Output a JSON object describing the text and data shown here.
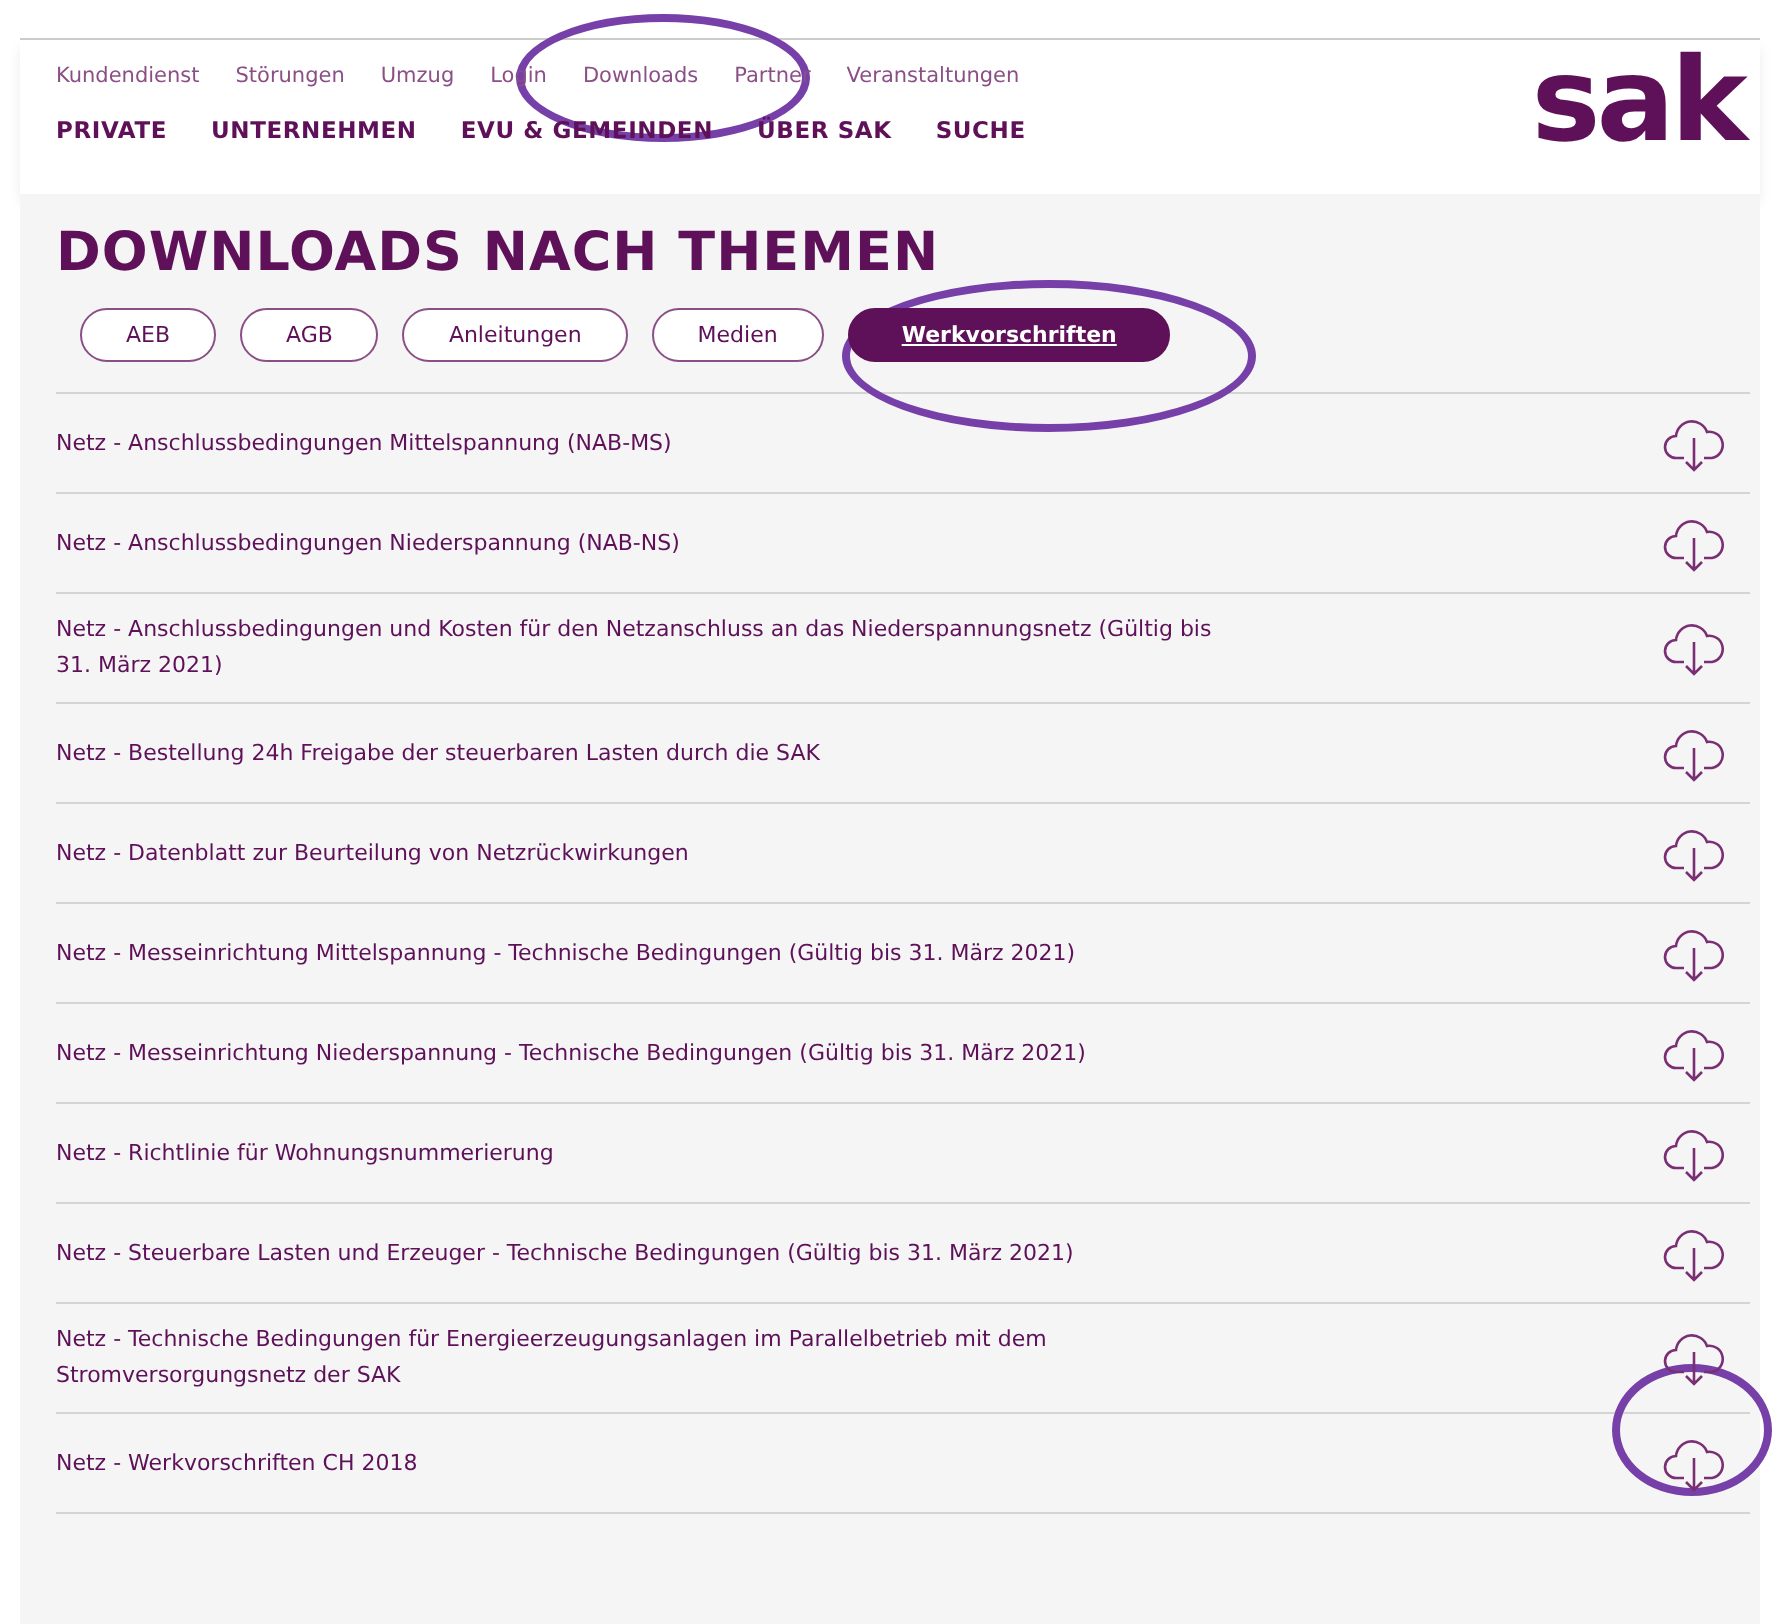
{
  "service_nav": [
    {
      "label": "Kundendienst"
    },
    {
      "label": "Störungen"
    },
    {
      "label": "Umzug"
    },
    {
      "label": "Login"
    },
    {
      "label": "Downloads"
    },
    {
      "label": "Partner"
    },
    {
      "label": "Veranstaltungen"
    }
  ],
  "main_nav": [
    {
      "label": "PRIVATE"
    },
    {
      "label": "UNTERNEHMEN"
    },
    {
      "label": "EVU & GEMEINDEN"
    },
    {
      "label": "ÜBER SAK"
    },
    {
      "label": "SUCHE"
    }
  ],
  "logo": "sak",
  "title": "DOWNLOADS NACH THEMEN",
  "filters": [
    {
      "label": "AEB",
      "selected": false
    },
    {
      "label": "AGB",
      "selected": false
    },
    {
      "label": "Anleitungen",
      "selected": false
    },
    {
      "label": "Medien",
      "selected": false
    },
    {
      "label": "Werkvorschriften",
      "selected": true
    }
  ],
  "documents": [
    {
      "title": "Netz - Anschlussbedingungen Mittelspannung (NAB-MS)"
    },
    {
      "title": "Netz - Anschlussbedingungen Niederspannung (NAB-NS)"
    },
    {
      "title": "Netz - Anschlussbedingungen und Kosten für den Netzanschluss an das Niederspannungsnetz (Gültig bis 31. März 2021)"
    },
    {
      "title": "Netz - Bestellung 24h Freigabe der steuerbaren Lasten durch die SAK"
    },
    {
      "title": "Netz - Datenblatt zur Beurteilung von Netzrückwirkungen"
    },
    {
      "title": "Netz - Messeinrichtung Mittelspannung - Technische Bedingungen (Gültig bis 31. März 2021)"
    },
    {
      "title": "Netz - Messeinrichtung Niederspannung - Technische Bedingungen (Gültig bis 31. März 2021)"
    },
    {
      "title": "Netz - Richtlinie für Wohnungsnummerierung"
    },
    {
      "title": "Netz - Steuerbare Lasten und Erzeuger - Technische Bedingungen (Gültig bis 31. März 2021)"
    },
    {
      "title": "Netz - Technische Bedingungen für Energieerzeugungsanlagen im Parallelbetrieb mit dem Stromversorgungsnetz der SAK"
    },
    {
      "title": "Netz - Werkvorschriften CH 2018"
    }
  ]
}
